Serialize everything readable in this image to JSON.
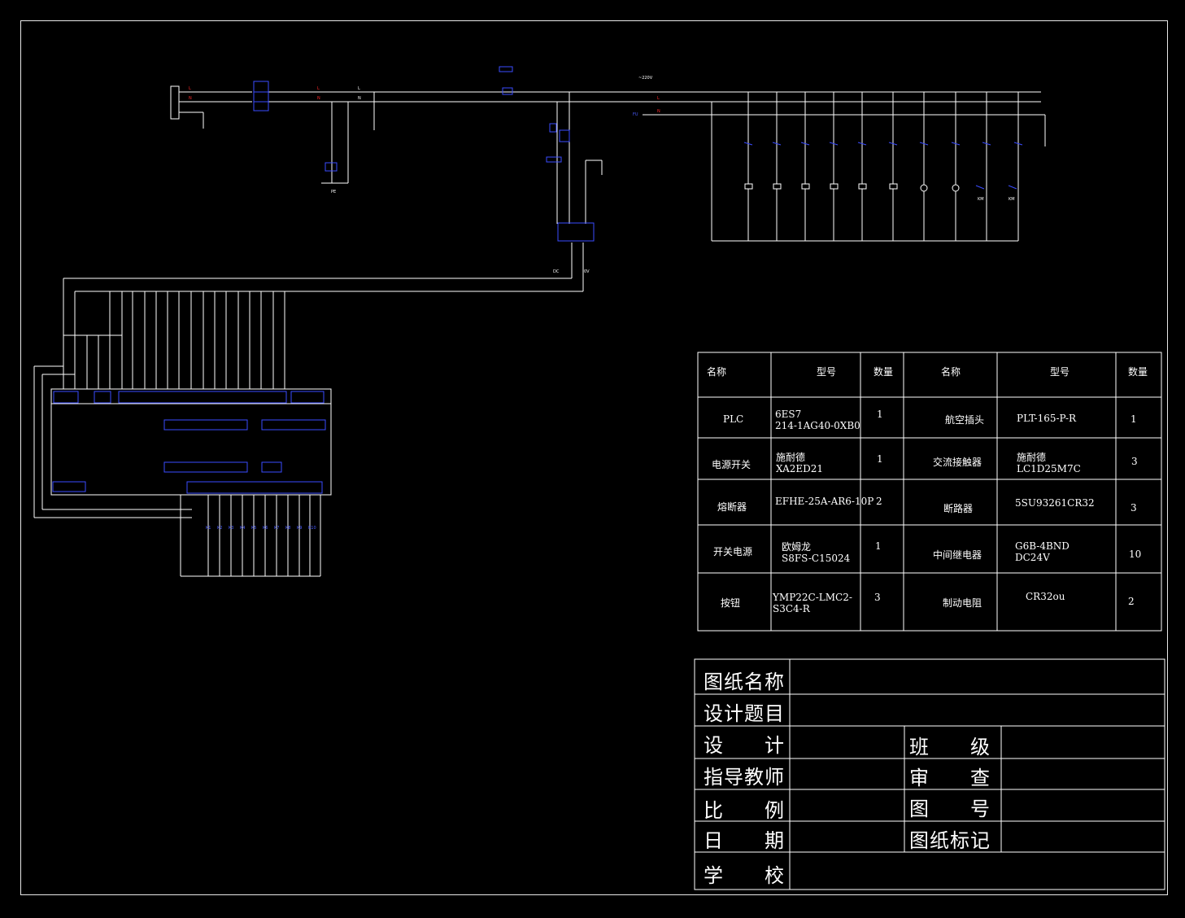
{
  "bom_table": {
    "headers": [
      "名称",
      "型号",
      "数量",
      "名称",
      "型号",
      "数量"
    ],
    "rows": [
      {
        "name1": "PLC",
        "model1": "6ES7\n214-1AG40-0XB0",
        "qty1": "1",
        "name2": "航空插头",
        "model2": "PLT-165-P-R",
        "qty2": "1"
      },
      {
        "name1": "电源开关",
        "model1": "施耐德\nXA2ED21",
        "qty1": "1",
        "name2": "交流接触器",
        "model2": "施耐德\nLC1D25M7C",
        "qty2": "3"
      },
      {
        "name1": "熔断器",
        "model1": "EFHE-25A-AR6-10P",
        "qty1": "2",
        "name2": "断路器",
        "model2": "5SU93261CR32",
        "qty2": "3"
      },
      {
        "name1": "开关电源",
        "model1": "欧姆龙\nS8FS-C15024",
        "qty1": "1",
        "name2": "中间继电器",
        "model2": "G6B-4BND\nDC24V",
        "qty2": "10"
      },
      {
        "name1": "按钮",
        "model1": "YMP22C-LMC2-\nS3C4-R",
        "qty1": "3",
        "name2": "制动电阻",
        "model2": "CR32ou",
        "qty2": "2"
      }
    ]
  },
  "title_block": {
    "drawing_name": "图纸名称",
    "design_topic": "设计题目",
    "designer": "设　　计",
    "class": "班　　级",
    "advisor": "指导教师",
    "review": "审　　查",
    "scale": "比　　例",
    "drawing_no": "图　　号",
    "date": "日　　期",
    "drawing_mark": "图纸标记",
    "school": "学　　校"
  },
  "colors": {
    "background": "#000000",
    "line": "#ffffff",
    "component": "#3a4cff",
    "label_red": "#ff2a2a"
  }
}
